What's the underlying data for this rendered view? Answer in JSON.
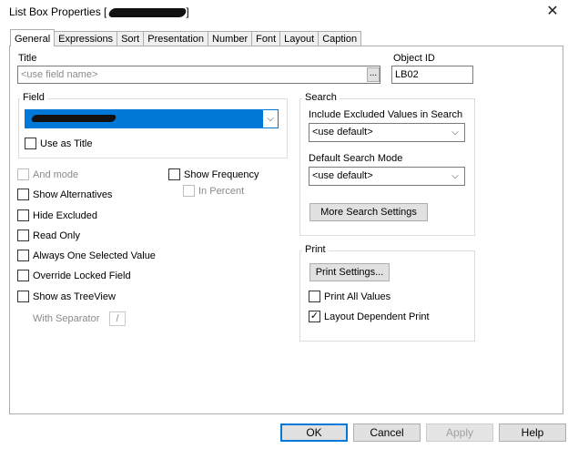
{
  "window": {
    "title": "List Box Properties [",
    "title_suffix": "]"
  },
  "tabs": [
    {
      "label": "General",
      "active": true
    },
    {
      "label": "Expressions"
    },
    {
      "label": "Sort"
    },
    {
      "label": "Presentation"
    },
    {
      "label": "Number"
    },
    {
      "label": "Font"
    },
    {
      "label": "Layout"
    },
    {
      "label": "Caption"
    }
  ],
  "title_field": {
    "label": "Title",
    "placeholder": "<use field name>",
    "browse_label": "..."
  },
  "object_id": {
    "label": "Object ID",
    "value": "LB02"
  },
  "field_group": {
    "label": "Field",
    "use_as_title": "Use as Title"
  },
  "options": {
    "and_mode": "And mode",
    "show_frequency": "Show Frequency",
    "in_percent": "In Percent",
    "show_alternatives": "Show Alternatives",
    "hide_excluded": "Hide Excluded",
    "read_only": "Read Only",
    "always_one_selected": "Always One Selected Value",
    "override_locked": "Override Locked Field",
    "show_as_treeview": "Show as TreeView",
    "with_separator": "With Separator",
    "separator_value": "/"
  },
  "search_group": {
    "label": "Search",
    "include_excluded_label": "Include Excluded Values in Search",
    "include_excluded_value": "<use default>",
    "default_mode_label": "Default Search Mode",
    "default_mode_value": "<use default>",
    "more_settings": "More Search Settings"
  },
  "print_group": {
    "label": "Print",
    "print_settings": "Print Settings...",
    "print_all_values": "Print All Values",
    "layout_dependent": "Layout Dependent Print",
    "layout_dependent_checked": true
  },
  "footer": {
    "ok": "OK",
    "cancel": "Cancel",
    "apply": "Apply",
    "help": "Help"
  },
  "colors": {
    "selection": "#0078d7",
    "ok_border": "#0078d7"
  }
}
